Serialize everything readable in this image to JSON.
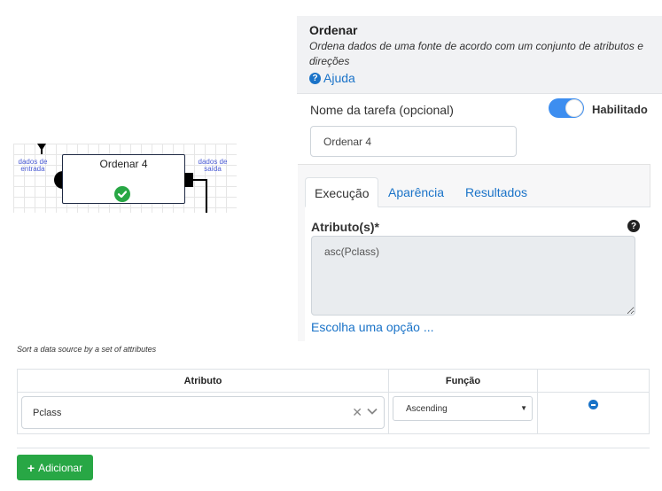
{
  "diagram": {
    "task_name": "Ordenar 4",
    "input_port_label": "dados de entrada",
    "output_port_label": "dados de saída",
    "status": "success"
  },
  "panel": {
    "op_title": "Ordenar",
    "op_description": "Ordena dados de uma fonte de acordo com um conjunto de atributos e direções",
    "help_label": "Ajuda",
    "task_name_label": "Nome da tarefa (opcional)",
    "task_name_value": "Ordenar 4",
    "enabled_label": "Habilitado",
    "enabled": true,
    "tabs": [
      {
        "label": "Execução",
        "active": true
      },
      {
        "label": "Aparência",
        "active": false
      },
      {
        "label": "Resultados",
        "active": false
      }
    ],
    "attributes_label": "Atributo(s)*",
    "attributes_value": "asc(Pclass)",
    "choose_option_label": "Escolha uma opção ..."
  },
  "editor": {
    "description": "Sort a data source by a set of attributes",
    "columns": [
      "Atributo",
      "Função",
      ""
    ],
    "rows": [
      {
        "attribute": "Pclass",
        "function": "Ascending"
      }
    ],
    "add_label": "Adicionar"
  },
  "colors": {
    "accent": "#1a73c8",
    "success": "#28a745",
    "toggle_on": "#3d8ef0"
  }
}
